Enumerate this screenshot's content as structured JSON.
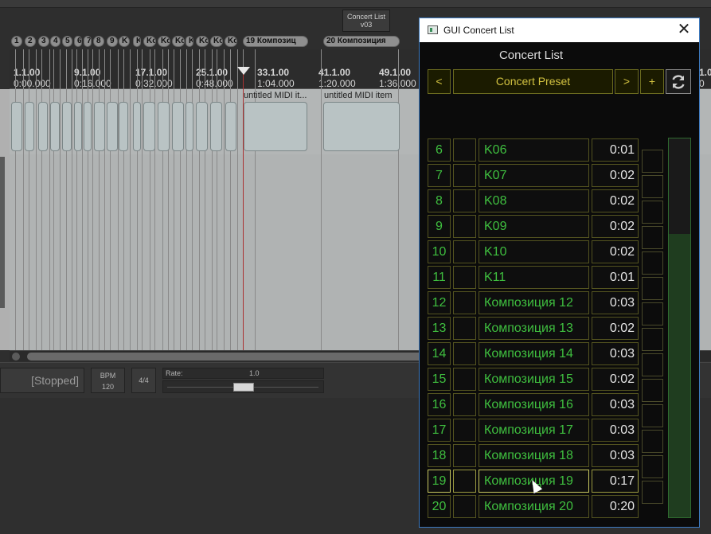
{
  "daw": {
    "concert_list_button": {
      "line1": "Concert List",
      "line2": "v03"
    },
    "regions": [
      "1",
      "2",
      "3",
      "4",
      "5",
      "6",
      "7",
      "8",
      "9",
      "K",
      "K",
      "Kc",
      "Kc",
      "Kc",
      "K",
      "Kc",
      "Kc",
      "Kc",
      "19  Композиц",
      "20  Композиция"
    ],
    "ruler_marks": [
      {
        "bar": "1.1.00",
        "time": "0:00.000"
      },
      {
        "bar": "9.1.00",
        "time": "0:16.000"
      },
      {
        "bar": "17.1.00",
        "time": "0:32.000"
      },
      {
        "bar": "25.1.00",
        "time": "0:48.000"
      },
      {
        "bar": "33.1.00",
        "time": "1:04.000"
      },
      {
        "bar": "41.1.00",
        "time": "1:20.000"
      },
      {
        "bar": "49.1.00",
        "time": "1:36.000"
      },
      {
        "bar": "1.0",
        "time": "0"
      }
    ],
    "item_labels": [
      "untitled MIDI it...",
      "untitled MIDI item"
    ],
    "transport": {
      "status": "[Stopped]",
      "bpm_label": "BPM",
      "bpm_value": "120",
      "time_signature": "4/4",
      "rate_label": "Rate:",
      "rate_value": "1.0"
    }
  },
  "concert_window": {
    "title": "GUI Concert List",
    "heading": "Concert List",
    "prev_label": "<",
    "preset_label": "Concert Preset",
    "next_label": ">",
    "add_label": "+",
    "refresh_icon": "refresh-icon",
    "close_glyph": "✕",
    "meter_level": 0.75,
    "rows": [
      {
        "num": "6",
        "name": "K06",
        "time": "0:01"
      },
      {
        "num": "7",
        "name": "K07",
        "time": "0:02"
      },
      {
        "num": "8",
        "name": "K08",
        "time": "0:02"
      },
      {
        "num": "9",
        "name": "K09",
        "time": "0:02"
      },
      {
        "num": "10",
        "name": "K10",
        "time": "0:02"
      },
      {
        "num": "11",
        "name": "K11",
        "time": "0:01"
      },
      {
        "num": "12",
        "name": "Композиция 12",
        "time": "0:03"
      },
      {
        "num": "13",
        "name": "Композиция 13",
        "time": "0:02"
      },
      {
        "num": "14",
        "name": "Композиция 14",
        "time": "0:03"
      },
      {
        "num": "15",
        "name": "Композиция 15",
        "time": "0:02"
      },
      {
        "num": "16",
        "name": "Композиция 16",
        "time": "0:03"
      },
      {
        "num": "17",
        "name": "Композиция 17",
        "time": "0:03"
      },
      {
        "num": "18",
        "name": "Композиция 18",
        "time": "0:03"
      },
      {
        "num": "19",
        "name": "Композиция 19",
        "time": "0:17"
      },
      {
        "num": "20",
        "name": "Композиция 20",
        "time": "0:20"
      }
    ]
  }
}
